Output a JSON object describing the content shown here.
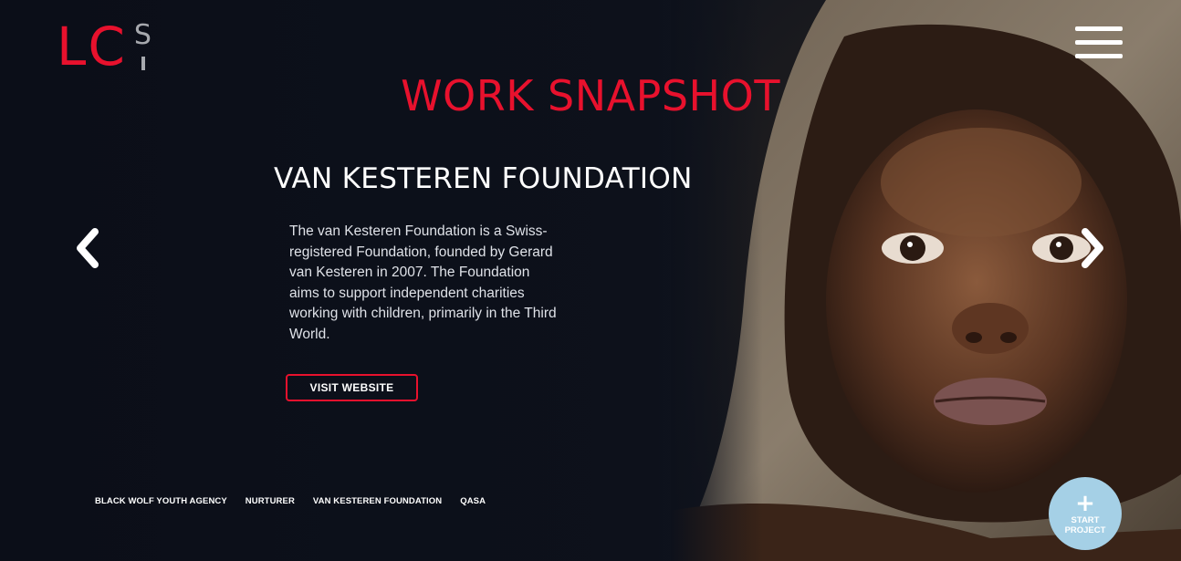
{
  "brand": {
    "logo_main": "LC",
    "logo_suffix": "S"
  },
  "header": {
    "title": "WORK SNAPSHOT"
  },
  "project": {
    "name": "VAN KESTEREN FOUNDATION",
    "description": "The van Kesteren Foundation is a Swiss-registered Foundation, founded by Gerard van Kesteren in 2007. The Foundation aims to support independent charities working with children, primarily in the Third World.",
    "cta_label": "VISIT WEBSITE"
  },
  "project_nav": [
    {
      "label": "BLACK WOLF YOUTH AGENCY"
    },
    {
      "label": "NURTURER"
    },
    {
      "label": "VAN KESTEREN FOUNDATION"
    },
    {
      "label": "QASA"
    }
  ],
  "start_project": {
    "label": "START PROJECT"
  },
  "icons": {
    "menu": "hamburger-menu-icon",
    "prev": "chevron-left-icon",
    "next": "chevron-right-icon",
    "plus": "plus-icon"
  },
  "colors": {
    "accent": "#e8112d",
    "background": "#0d1019",
    "start_button": "#a5d0e6",
    "logo_suffix": "#a7a9ae"
  }
}
